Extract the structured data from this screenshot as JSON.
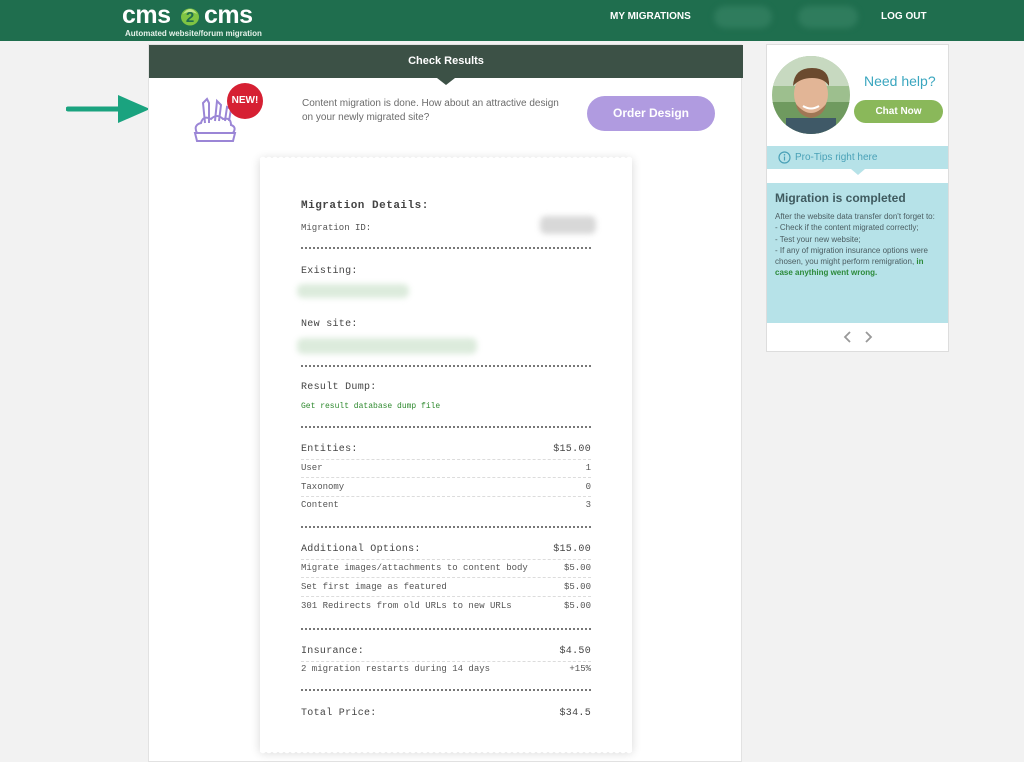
{
  "header": {
    "logo_left": "cms",
    "logo_right": "cms",
    "logo_tagline": "Automated website/forum migration",
    "nav_migrations": "MY MIGRATIONS",
    "nav_logout": "LOG OUT"
  },
  "panel": {
    "title": "Check Results",
    "new_badge": "NEW!",
    "promo_text": "Content migration is done. How about an attractive design on your newly migrated site?",
    "order_button": "Order Design"
  },
  "receipt": {
    "details_title": "Migration Details:",
    "migration_id_label": "Migration ID:",
    "existing_label": "Existing:",
    "new_site_label": "New site:",
    "result_dump_label": "Result Dump:",
    "result_dump_link": "Get result database dump file",
    "entities": {
      "label": "Entities:",
      "total": "$15.00",
      "items": [
        {
          "name": "User",
          "value": "1"
        },
        {
          "name": "Taxonomy",
          "value": "0"
        },
        {
          "name": "Content",
          "value": "3"
        }
      ]
    },
    "options": {
      "label": "Additional Options:",
      "total": "$15.00",
      "items": [
        {
          "name": "Migrate images/attachments to content body",
          "value": "$5.00"
        },
        {
          "name": "Set first image as featured",
          "value": "$5.00"
        },
        {
          "name": "301 Redirects from old URLs to new URLs",
          "value": "$5.00"
        }
      ]
    },
    "insurance": {
      "label": "Insurance:",
      "total": "$4.50",
      "items": [
        {
          "name": "2 migration restarts during 14 days",
          "value": "+15%"
        }
      ]
    },
    "total_label": "Total Price:",
    "total_value": "$34.5"
  },
  "sidebar": {
    "need_help": "Need help?",
    "chat_button": "Chat Now",
    "protips_label": "Pro-Tips right here",
    "tip_title": "Migration is completed",
    "tip_body_1": "After the website data transfer don't forget to:",
    "tip_body_2": "- Check if the content migrated correctly;",
    "tip_body_3": "- Test your new website;",
    "tip_body_4": "- If any of migration insurance options were chosen, you might perform remigration,",
    "tip_body_hl": "in case anything went wrong."
  },
  "colors": {
    "header_green": "#1f6e4e",
    "panel_head": "#3c5146",
    "order_purple": "#b09be0",
    "badge_red": "#d62033",
    "chat_green": "#8ab85a",
    "tip_blue": "#b6e2e8",
    "arrow_teal": "#1aa37f"
  },
  "icons": {
    "promo": "design-tools-icon",
    "info": "info-icon",
    "prev": "chevron-left-icon",
    "next": "chevron-right-icon",
    "annotation": "arrow-right-icon"
  }
}
